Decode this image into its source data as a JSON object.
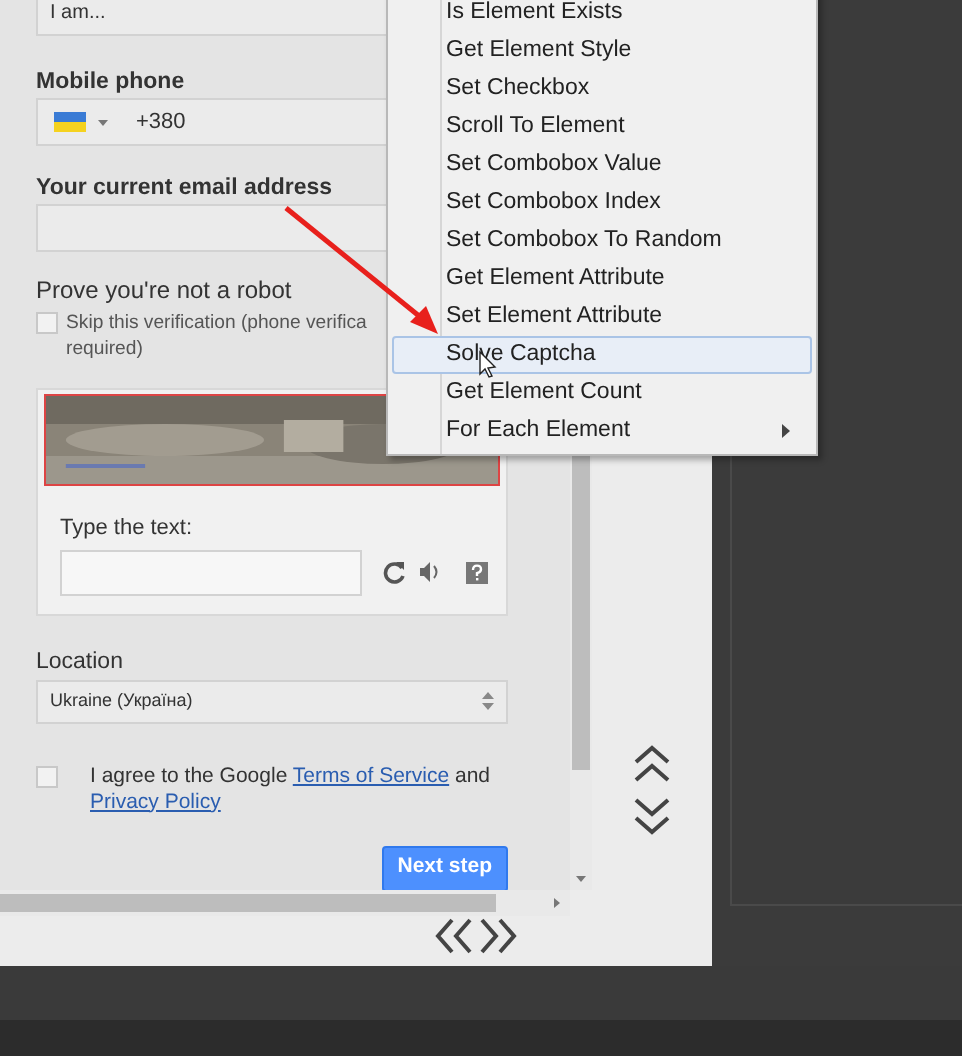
{
  "form": {
    "gender_field": {
      "value": "I am..."
    },
    "phone": {
      "label": "Mobile phone",
      "value": "+380"
    },
    "email": {
      "label": "Your current email address"
    },
    "robot": {
      "heading": "Prove you're not a robot",
      "skip": {
        "checked": false,
        "lines": [
          "Skip this verification (phone verifica",
          "required)"
        ]
      },
      "captcha": {
        "prompt": "Type the text:"
      }
    },
    "location": {
      "label": "Location",
      "value": "Ukraine (Україна)"
    },
    "terms": {
      "checked": false,
      "parts": [
        {
          "kind": "text",
          "text": "I agree to the Google "
        },
        {
          "kind": "link",
          "text": "Terms of Service"
        },
        {
          "kind": "text",
          "text": " and "
        },
        {
          "kind": "link",
          "text": "Privacy Policy"
        }
      ]
    },
    "next_button": "Next step"
  },
  "context_menu": {
    "items": [
      {
        "label": "Is Element Exists",
        "selected": false,
        "submenu": false
      },
      {
        "label": "Get Element Style",
        "selected": false,
        "submenu": false
      },
      {
        "label": "Set Checkbox",
        "selected": false,
        "submenu": false
      },
      {
        "label": "Scroll To Element",
        "selected": false,
        "submenu": false
      },
      {
        "label": "Set Combobox Value",
        "selected": false,
        "submenu": false
      },
      {
        "label": "Set Combobox Index",
        "selected": false,
        "submenu": false
      },
      {
        "label": "Set Combobox To Random",
        "selected": false,
        "submenu": false
      },
      {
        "label": "Get Element Attribute",
        "selected": false,
        "submenu": false
      },
      {
        "label": "Set Element Attribute",
        "selected": false,
        "submenu": false
      },
      {
        "label": "Solve Captcha",
        "selected": true,
        "submenu": false
      },
      {
        "label": "Get Element Count",
        "selected": false,
        "submenu": false
      },
      {
        "label": "For Each Element",
        "selected": false,
        "submenu": true
      }
    ]
  }
}
